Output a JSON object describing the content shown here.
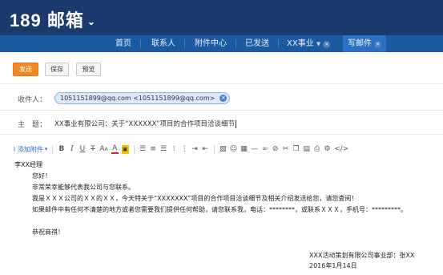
{
  "header": {
    "logo": "189 邮箱",
    "chevron": "⌄"
  },
  "nav": {
    "items": [
      {
        "label": "首页"
      },
      {
        "label": "联系人"
      },
      {
        "label": "附件中心"
      },
      {
        "label": "已发送"
      },
      {
        "label": "XX事业"
      },
      {
        "label": "写邮件"
      }
    ]
  },
  "actions": {
    "send": "发送",
    "save": "保存",
    "preview": "预览"
  },
  "compose": {
    "to_label": "收件人：",
    "recipient": "1051151899@qq.com <1051151899@qq.com>",
    "subject_label": "主　题：",
    "subject": "XX事业有限公司：关于“XXXXXX”项目的合作项目洽谈细节"
  },
  "toolbar": {
    "attach": "添加附件"
  },
  "body": {
    "lines": [
      "李XX经理",
      "您好！",
      "非常荣幸能够代表我公司与您联系。",
      "我是ＸＸＸ公司的ＸＸ的ＸＸ，今天特关于“XXXXXXX”项目的合作项目洽谈细节及相关介绍发送给您，请您查阅！",
      "如果邮件中有任何不清楚的地方或者您需要我们提供任何帮助，请您联系我，电话：********，或联系ＸＸＸ，手机号：*********。",
      "恭祝商祺！"
    ],
    "signature": "XXX活动策划有限公司事业部：张XX",
    "date": "2016年1月14日"
  }
}
